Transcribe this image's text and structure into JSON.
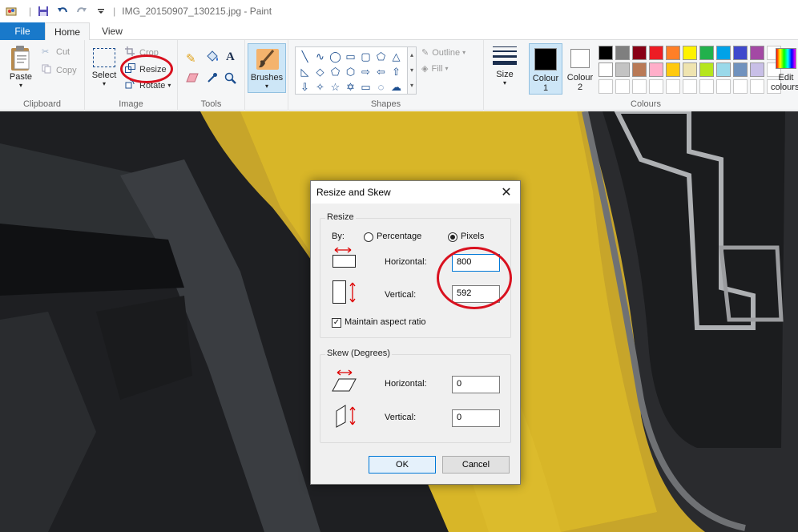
{
  "window": {
    "title": "IMG_20150907_130215.jpg - Paint"
  },
  "tabs": {
    "file": "File",
    "home": "Home",
    "view": "View"
  },
  "clipboard": {
    "paste": "Paste",
    "cut": "Cut",
    "copy": "Copy",
    "group": "Clipboard"
  },
  "image": {
    "select": "Select",
    "crop": "Crop",
    "resize": "Resize",
    "rotate": "Rotate",
    "group": "Image"
  },
  "tools": {
    "group": "Tools"
  },
  "brushes": {
    "label": "Brushes"
  },
  "shapes": {
    "outline": "Outline",
    "fill": "Fill",
    "group": "Shapes"
  },
  "size": {
    "label": "Size"
  },
  "colours": {
    "colour1": "Colour 1",
    "colour1_value": "#000000",
    "colour2_line1": "Colour",
    "colour2_line2": "2",
    "colour2_value": "#ffffff",
    "edit_line1": "Edit",
    "edit_line2": "colours",
    "group": "Colours",
    "palette_row1": [
      "#000000",
      "#7f7f7f",
      "#880015",
      "#ed1c24",
      "#ff7f27",
      "#fff200",
      "#22b14c",
      "#00a2e8",
      "#3f48cc",
      "#a349a4"
    ],
    "palette_row2": [
      "#ffffff",
      "#c3c3c3",
      "#b97a57",
      "#ffaec9",
      "#ffc90e",
      "#efe4b0",
      "#b5e61d",
      "#99d9ea",
      "#7092be",
      "#c8bfe7"
    ]
  },
  "dialog": {
    "title": "Resize and Skew",
    "resize_legend": "Resize",
    "by_label": "By:",
    "percentage": "Percentage",
    "pixels": "Pixels",
    "pixels_selected": true,
    "horizontal_label": "Horizontal:",
    "horizontal_value": "800",
    "vertical_label": "Vertical:",
    "vertical_value": "592",
    "maintain_aspect": "Maintain aspect ratio",
    "maintain_checked": true,
    "skew_legend": "Skew (Degrees)",
    "skew_horizontal_label": "Horizontal:",
    "skew_horizontal_value": "0",
    "skew_vertical_label": "Vertical:",
    "skew_vertical_value": "0",
    "ok": "OK",
    "cancel": "Cancel"
  }
}
